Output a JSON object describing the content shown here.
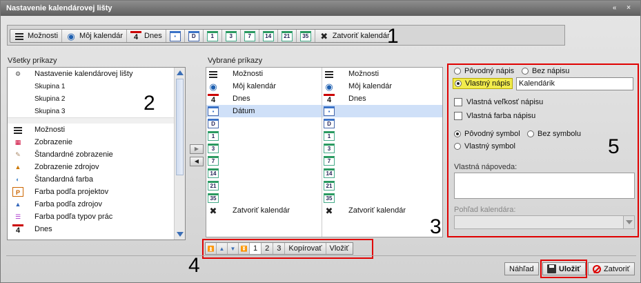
{
  "window": {
    "title": "Nastavenie kalendárovej lišty",
    "controls": "« ×"
  },
  "annotations": {
    "n1": "1",
    "n2": "2",
    "n3": "3",
    "n4": "4",
    "n5": "5"
  },
  "toolbar": {
    "items": [
      {
        "label": "Možnosti",
        "icon": "menu-icon"
      },
      {
        "label": "Môj kalendár",
        "icon": "eye-icon"
      },
      {
        "label": "Dnes",
        "icon": "today-four-icon",
        "icon_text": "4"
      },
      {
        "label": "",
        "icon": "calendar-date-icon"
      },
      {
        "label": "",
        "icon": "calendar-day-icon",
        "icon_text": "D"
      },
      {
        "label": "",
        "icon": "calendar-1-icon",
        "icon_text": "1"
      },
      {
        "label": "",
        "icon": "calendar-3-icon",
        "icon_text": "3"
      },
      {
        "label": "",
        "icon": "calendar-7-icon",
        "icon_text": "7"
      },
      {
        "label": "",
        "icon": "calendar-14-icon",
        "icon_text": "14"
      },
      {
        "label": "",
        "icon": "calendar-21-icon",
        "icon_text": "21"
      },
      {
        "label": "",
        "icon": "calendar-35-icon",
        "icon_text": "35"
      },
      {
        "label": "Zatvoriť kalendár",
        "icon": "close-icon"
      }
    ]
  },
  "all_commands": {
    "heading": "Všetky príkazy",
    "items": [
      {
        "label": "Nastavenie kalendárovej lišty",
        "icon": "settings-people-icon"
      },
      {
        "label": "Skupina 1",
        "sub": true
      },
      {
        "label": "Skupina 2",
        "sub": true
      },
      {
        "label": "Skupina 3",
        "sub": true
      },
      {
        "label": "Možnosti",
        "icon": "menu-icon"
      },
      {
        "label": "Zobrazenie",
        "icon": "view-grid-icon"
      },
      {
        "label": "Štandardné zobrazenie",
        "icon": "standard-view-icon"
      },
      {
        "label": "Zobrazenie zdrojov",
        "icon": "resources-view-icon"
      },
      {
        "label": "Štandardná farba",
        "icon": "standard-color-icon"
      },
      {
        "label": "Farba podľa projektov",
        "icon": "project-color-icon"
      },
      {
        "label": "Farba podľa zdrojov",
        "icon": "resource-color-icon"
      },
      {
        "label": "Farba podľa typov prác",
        "icon": "worktype-color-icon"
      },
      {
        "label": "Dnes",
        "icon": "today-four-icon",
        "icon_text": "4"
      }
    ]
  },
  "selected_commands": {
    "heading": "Vybrané príkazy",
    "col1": [
      {
        "label": "Možnosti",
        "icon": "menu-icon"
      },
      {
        "label": "Môj kalendár",
        "icon": "eye-icon"
      },
      {
        "label": "Dnes",
        "icon": "today-four-icon",
        "icon_text": "4"
      },
      {
        "label": "Dátum",
        "icon": "calendar-date-icon",
        "selected": true
      },
      {
        "label": "",
        "icon": "calendar-day-icon",
        "icon_text": "D"
      },
      {
        "label": "",
        "icon": "calendar-1-icon",
        "icon_text": "1"
      },
      {
        "label": "",
        "icon": "calendar-3-icon",
        "icon_text": "3"
      },
      {
        "label": "",
        "icon": "calendar-7-icon",
        "icon_text": "7"
      },
      {
        "label": "",
        "icon": "calendar-14-icon",
        "icon_text": "14"
      },
      {
        "label": "",
        "icon": "calendar-21-icon",
        "icon_text": "21"
      },
      {
        "label": "",
        "icon": "calendar-35-icon",
        "icon_text": "35"
      },
      {
        "label": "Zatvoriť kalendár",
        "icon": "close-icon"
      }
    ],
    "col2": [
      {
        "label": "Možnosti",
        "icon": "menu-icon"
      },
      {
        "label": "Môj kalendár",
        "icon": "eye-icon"
      },
      {
        "label": "Dnes",
        "icon": "today-four-icon",
        "icon_text": "4"
      },
      {
        "label": "",
        "icon": "calendar-date-icon"
      },
      {
        "label": "",
        "icon": "calendar-day-icon",
        "icon_text": "D"
      },
      {
        "label": "",
        "icon": "calendar-1-icon",
        "icon_text": "1"
      },
      {
        "label": "",
        "icon": "calendar-3-icon",
        "icon_text": "3"
      },
      {
        "label": "",
        "icon": "calendar-7-icon",
        "icon_text": "7"
      },
      {
        "label": "",
        "icon": "calendar-14-icon",
        "icon_text": "14"
      },
      {
        "label": "",
        "icon": "calendar-21-icon",
        "icon_text": "21"
      },
      {
        "label": "",
        "icon": "calendar-35-icon",
        "icon_text": "35"
      },
      {
        "label": "Zatvoriť kalendár",
        "icon": "close-icon"
      }
    ]
  },
  "pager": {
    "pages": [
      "1",
      "2",
      "3"
    ],
    "active_page": "1",
    "copy_label": "Kopírovať",
    "paste_label": "Vložiť"
  },
  "properties": {
    "original_caption": "Pôvodný nápis",
    "no_caption": "Bez nápisu",
    "custom_caption": "Vlastný nápis",
    "custom_caption_value": "Kalendárik",
    "custom_size": "Vlastná veľkosť nápisu",
    "custom_color": "Vlastná farba nápisu",
    "original_symbol": "Pôvodný symbol",
    "no_symbol": "Bez symbolu",
    "custom_symbol": "Vlastný symbol",
    "custom_help_label": "Vlastná nápoveda:",
    "calendar_view_label": "Pohľad kalendára:"
  },
  "footer": {
    "preview_label": "Náhľad",
    "save_label": "Uložiť",
    "close_label": "Zatvoriť"
  },
  "colors": {
    "highlight_frame": "#e00000",
    "selected_row": "#cfe0f8",
    "caption_highlight": "#f2ec4c"
  }
}
